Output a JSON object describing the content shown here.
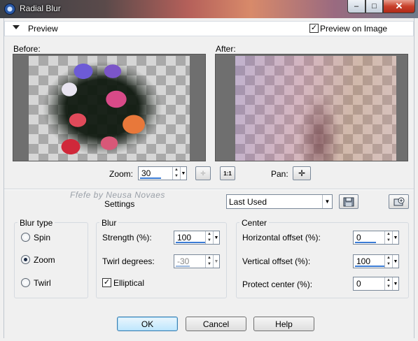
{
  "window": {
    "title": "Radial Blur",
    "controls": {
      "minimize": "–",
      "maximize": "□",
      "close": "✕"
    }
  },
  "preview": {
    "label": "Preview",
    "preview_on_image": {
      "label": "Preview on Image",
      "checked": true
    },
    "before_label": "Before:",
    "after_label": "After:",
    "zoom_label": "Zoom:",
    "zoom_value": "30",
    "zoom_fit_icon": "✛",
    "zoom_1to1": "1:1",
    "pan_label": "Pan:",
    "pan_icon": "✛"
  },
  "watermark": "Ffefe by Neusa Novaes",
  "settings": {
    "label": "Settings",
    "preset": "Last Used",
    "dropdown_arrow": "▼"
  },
  "blur_type": {
    "title": "Blur type",
    "options": [
      {
        "label": "Spin",
        "selected": false
      },
      {
        "label": "Zoom",
        "selected": true
      },
      {
        "label": "Twirl",
        "selected": false
      }
    ]
  },
  "blur": {
    "title": "Blur",
    "strength_label": "Strength (%):",
    "strength_value": "100",
    "strength_level": 1.0,
    "twirl_label": "Twirl degrees:",
    "twirl_value": "-30",
    "twirl_enabled": false,
    "elliptical_label": "Elliptical",
    "elliptical_checked": true
  },
  "center": {
    "title": "Center",
    "h_offset_label": "Horizontal offset (%):",
    "h_offset_value": "0",
    "v_offset_label": "Vertical offset (%):",
    "v_offset_value": "100",
    "protect_label": "Protect center (%):",
    "protect_value": "0"
  },
  "buttons": {
    "ok": "OK",
    "cancel": "Cancel",
    "help": "Help"
  },
  "icons": {
    "spin_up": "▲",
    "spin_down": "▼",
    "checkmark": "✓"
  }
}
